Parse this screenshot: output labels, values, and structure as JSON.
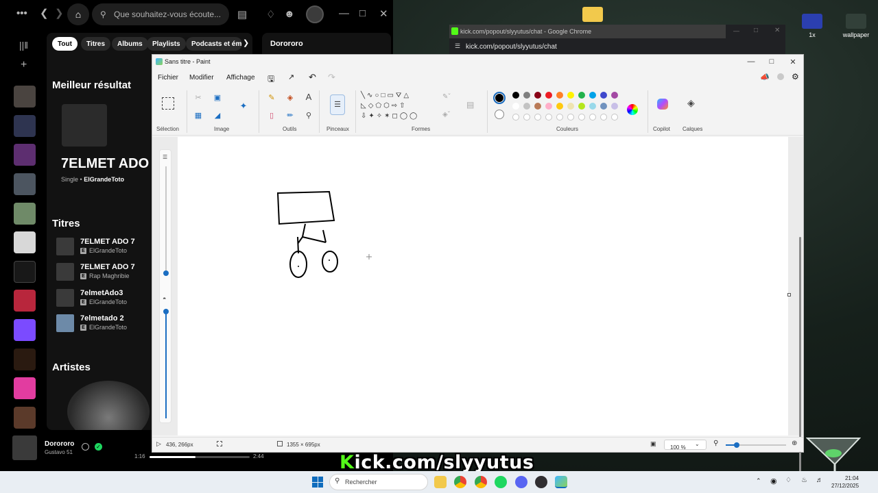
{
  "desktop": {
    "icons": [
      {
        "label": "1x"
      },
      {
        "label": "wallpaper"
      }
    ]
  },
  "spotify": {
    "search_placeholder": "Que souhaitez-vous écoute...",
    "chips": [
      "Tout",
      "Titres",
      "Albums",
      "Playlists",
      "Podcasts et émi"
    ],
    "best_result": {
      "heading": "Meilleur résultat",
      "title": "7ELMET ADO",
      "type": "Single",
      "artist": "ElGrandeToto"
    },
    "tracks_heading": "Titres",
    "tracks": [
      {
        "title": "7ELMET ADO 7",
        "artist": "ElGrandeToto"
      },
      {
        "title": "7ELMET ADO 7",
        "artist": "Rap Maghribie"
      },
      {
        "title": "7elmetAdo3",
        "artist": "ElGrandeToto"
      },
      {
        "title": "7elmetado 2",
        "artist": "ElGrandeToto"
      }
    ],
    "explicit_badge": "E",
    "artists_heading": "Artistes",
    "right_panel_title": "Dorororo",
    "now_playing": {
      "title": "Dorororo",
      "artist": "Gustavo 51",
      "elapsed": "1:16",
      "duration": "2:44",
      "progress": 0.46
    }
  },
  "chrome": {
    "window_title": "kick.com/popout/slyyutus/chat - Google Chrome",
    "url": "kick.com/popout/slyyutus/chat"
  },
  "paint": {
    "title": "Sans titre - Paint",
    "menu": [
      "Fichier",
      "Modifier",
      "Affichage"
    ],
    "groups": [
      "Sélection",
      "Image",
      "Outils",
      "Pinceaux",
      "Formes",
      "Couleurs",
      "Copilot",
      "Calques"
    ],
    "palette": [
      "#000000",
      "#7f7f7f",
      "#880015",
      "#ed1c24",
      "#ff7f27",
      "#fff200",
      "#22b14c",
      "#00a2e8",
      "#3f48cc",
      "#a349a4"
    ],
    "palette2": [
      "#ffffff",
      "#c3c3c3",
      "#b97a57",
      "#ffaec9",
      "#ffc90e",
      "#efe4b0",
      "#b5e61d",
      "#99d9ea",
      "#7092be",
      "#c8bfe7"
    ],
    "status": {
      "cursor": "436, 266px",
      "canvas_size": "1355 × 695px",
      "zoom": "100 %"
    }
  },
  "overlay": {
    "k": "K",
    "text": "ick.com/slyyutus"
  },
  "taskbar": {
    "search": "Rechercher",
    "time": "21:04",
    "date": "27/12/2025"
  }
}
